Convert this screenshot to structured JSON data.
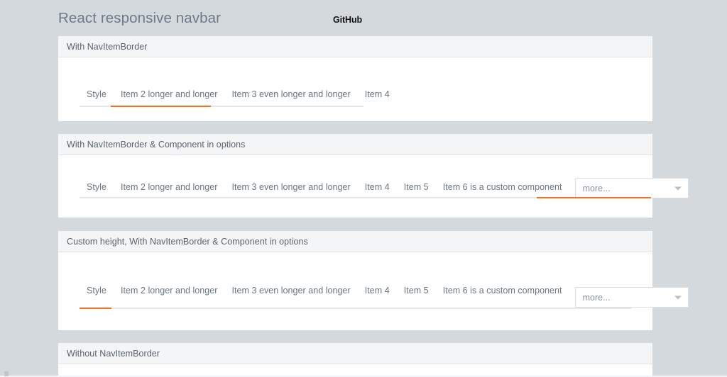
{
  "header": {
    "title": "React responsive navbar",
    "github_label": "GitHub"
  },
  "colors": {
    "page_background": "#d4d9dd",
    "card_background": "#ffffff",
    "card_header_background": "#f4f5f6",
    "accent_orange": "#f37021",
    "nav_text": "#6b7680",
    "title_text": "#6e7a87",
    "track_gray": "#e4e6e8"
  },
  "sections": [
    {
      "title": "With NavItemBorder",
      "nav_items": [
        {
          "label": "Style",
          "active": false
        },
        {
          "label": "Item 2 longer and longer",
          "active": true
        },
        {
          "label": "Item 3 even longer and longer",
          "active": false
        },
        {
          "label": "Item 4",
          "active": false
        }
      ],
      "more": null
    },
    {
      "title": "With NavItemBorder & Component in options",
      "nav_items": [
        {
          "label": "Style",
          "active": false
        },
        {
          "label": "Item 2 longer and longer",
          "active": false
        },
        {
          "label": "Item 3 even longer and longer",
          "active": false
        },
        {
          "label": "Item 4",
          "active": false
        },
        {
          "label": "Item 5",
          "active": false
        },
        {
          "label": "Item 6 is a custom component",
          "active": false
        }
      ],
      "more": {
        "label": "more...",
        "active": true,
        "icon": "chevron-down-icon"
      }
    },
    {
      "title": "Custom height, With NavItemBorder & Component in options",
      "nav_items": [
        {
          "label": "Style",
          "active": true
        },
        {
          "label": "Item 2 longer and longer",
          "active": false
        },
        {
          "label": "Item 3 even longer and longer",
          "active": false
        },
        {
          "label": "Item 4",
          "active": false
        },
        {
          "label": "Item 5",
          "active": false
        },
        {
          "label": "Item 6 is a custom component",
          "active": false
        }
      ],
      "more": {
        "label": "more...",
        "active": false,
        "icon": "chevron-down-icon"
      }
    },
    {
      "title": "Without NavItemBorder",
      "nav_items": [],
      "more": null
    }
  ]
}
